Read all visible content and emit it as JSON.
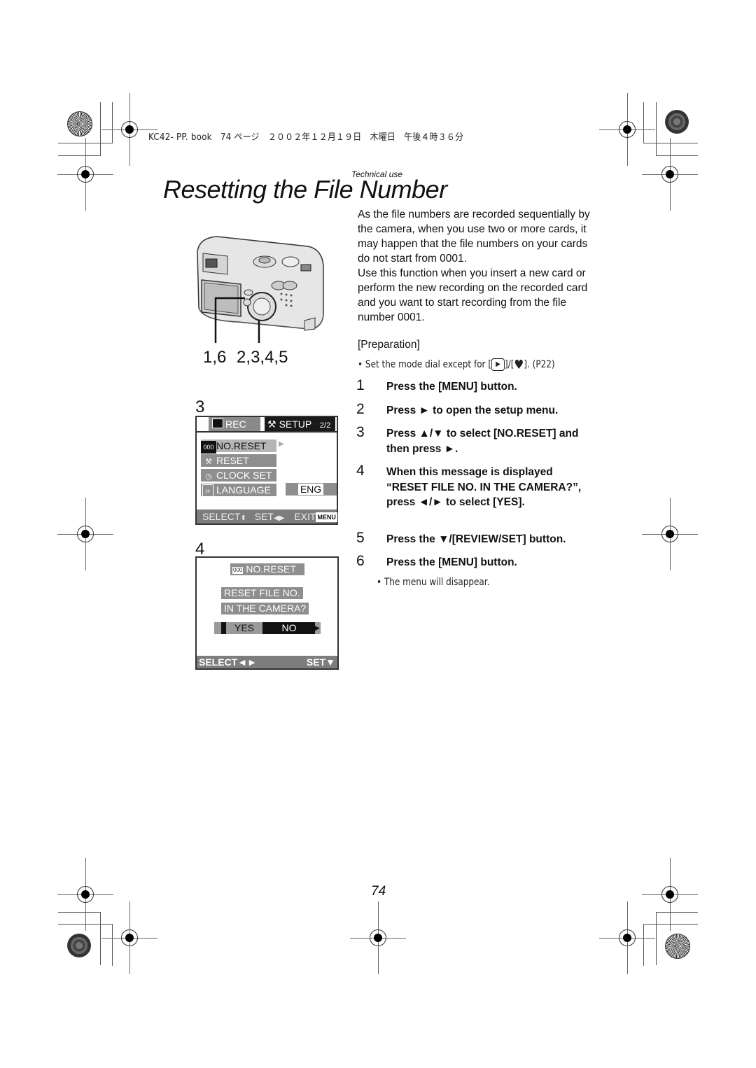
{
  "print_header": "KC42- PP. book　74 ページ　２００２年１２月１９日　木曜日　午後４時３６分",
  "section_tag": "Technical use",
  "title": "Resetting the File Number",
  "camera_callouts": {
    "left": "1,6",
    "right": "2,3,4,5"
  },
  "intro_paragraph_1": "As the file numbers are recorded sequentially by the camera, when you use two or more cards, it may happen that the file numbers on your cards do not start from 0001.",
  "intro_paragraph_2": "Use this function when you insert a new card or perform the new recording on the recorded card and you want to start recording from the file number 0001.",
  "preparation": {
    "heading": "[Preparation]",
    "bullet_prefix": "• Set the mode dial except for [",
    "bullet_mid": "]/[",
    "bullet_suffix": "]. (P22)",
    "icon1": "play-icon",
    "icon2": "heart-icon"
  },
  "steps": [
    {
      "num": "1",
      "text": "Press the [MENU] button."
    },
    {
      "num": "2",
      "text": "Press ► to open the setup menu."
    },
    {
      "num": "3",
      "text": "Press ▲/▼ to select [NO.RESET] and then press ►."
    },
    {
      "num": "4",
      "text": "When this message is displayed “RESET FILE NO. IN THE CAMERA?”, press ◄/► to select [YES]."
    },
    {
      "num": "5",
      "text": "Press the ▼/[REVIEW/SET] button."
    },
    {
      "num": "6",
      "text": "Press the [MENU] button."
    }
  ],
  "step6_note": "• The menu will disappear.",
  "screen3": {
    "label": "3",
    "tab_rec": "REC",
    "tab_setup": "SETUP",
    "page": "2/2",
    "items": [
      {
        "icon": "000",
        "label": "NO.RESET",
        "selected": true
      },
      {
        "icon": "⚒",
        "label": "RESET",
        "selected": false
      },
      {
        "icon": "◷",
        "label": "CLOCK SET",
        "selected": false
      },
      {
        "icon": "i+",
        "label": "LANGUAGE",
        "selected": false
      }
    ],
    "language_value": "ENG",
    "footer_select": "SELECT",
    "footer_set": "SET",
    "footer_exit": "EXIT",
    "footer_menu": "MENU"
  },
  "screen4": {
    "label": "4",
    "title": "NO.RESET",
    "message_line1": "RESET FILE NO.",
    "message_line2": "IN THE CAMERA?",
    "yes": "YES",
    "no": "NO",
    "footer_select": "SELECT◄►",
    "footer_set": "SET▼"
  },
  "page_number": "74"
}
